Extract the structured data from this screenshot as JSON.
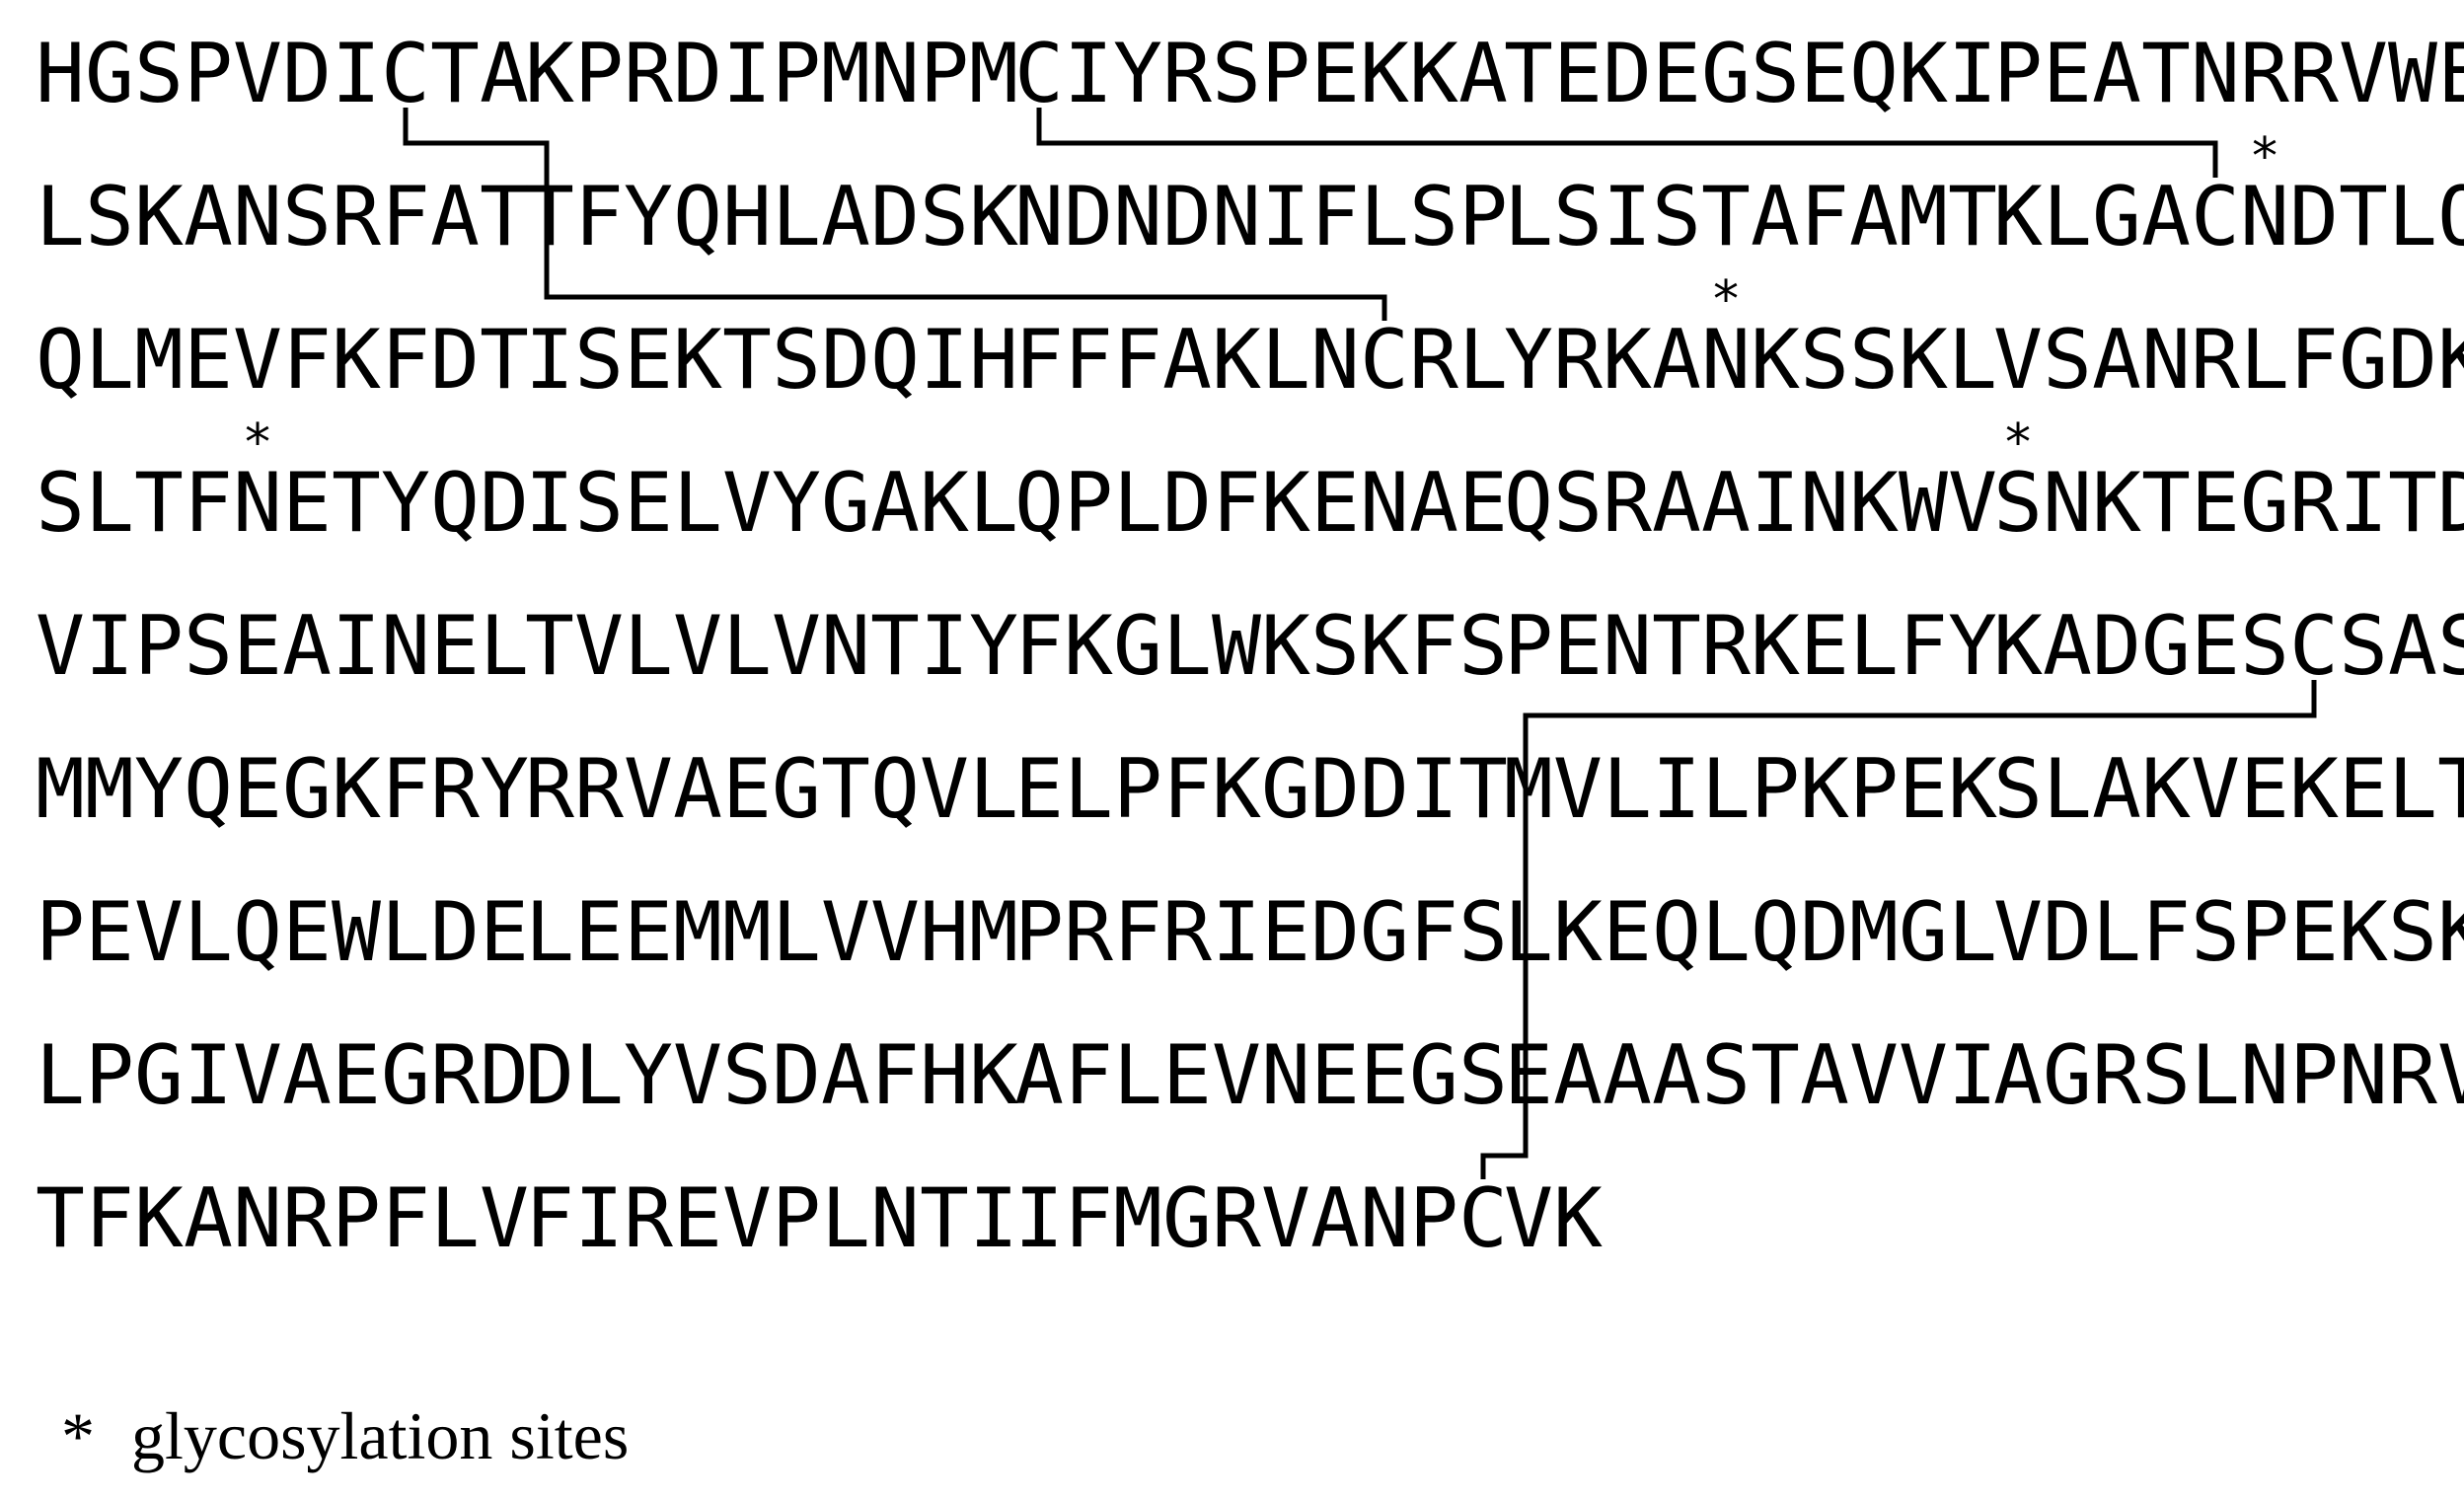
{
  "sequence_lines": [
    [
      "HGSPVDICTA",
      "KPRDIPMNPM",
      "CIYRSPEKKA",
      "TEDEGSEQKI",
      "PEATNRRVWE"
    ],
    [
      "LSKANSRFAT",
      "TFYQHLADSK",
      "NDNDNIFLSP",
      "LSISTAFAMT",
      "KLGACNDTLQ"
    ],
    [
      "QLMEVFKFDT",
      "ISEKTSDQIH",
      "FFFAKLNCRL",
      "YRKANKSSKL",
      "VSANRLFGDK"
    ],
    [
      "SLTFNETYQD",
      "ISELVYGAKL",
      "QPLDFKENAE",
      "QSRAAINKWV",
      "SNKTEGRITD"
    ],
    [
      "VIPSEAINEL",
      "TVLVLVNTIY",
      "FKGLWKSKFS",
      "PENTRKELFY",
      "KADGESCSAS"
    ],
    [
      "MMYQEGKFRY",
      "RRVAEGTQVL",
      "ELPFKGDDIT",
      "MVLILPKPEK",
      "SLAKVEKELT"
    ],
    [
      "PEVLQEWLDE",
      "LEEMMLVVHM",
      "PRFRIEDGFS",
      "LKEQLQDMGL",
      "VDLFSPEKSK"
    ],
    [
      "LPGIVAEGRD",
      "DLYVSDAFHK",
      "AFLEVNEEGS",
      "EAAASTAVVI",
      "AGRSLNPNRV"
    ],
    [
      "TFKANRPFLV",
      "FIREVPLNTI",
      "IFMGRVANPC",
      "VK"
    ]
  ],
  "glycosylation_marker": "*",
  "glycosylation_sites": [
    {
      "line": 1,
      "block": 4,
      "residue": 5
    },
    {
      "line": 2,
      "block": 3,
      "residue": 4
    },
    {
      "line": 3,
      "block": 0,
      "residue": 4
    },
    {
      "line": 3,
      "block": 4,
      "residue": 0
    }
  ],
  "disulfide_bonds": [
    {
      "from": {
        "line": 0,
        "block": 0,
        "residue": 7
      },
      "to": {
        "line": 2,
        "block": 2,
        "residue": 7
      }
    },
    {
      "from": {
        "line": 0,
        "block": 2,
        "residue": 0
      },
      "to": {
        "line": 1,
        "block": 4,
        "residue": 4
      }
    },
    {
      "from": {
        "line": 4,
        "block": 4,
        "residue": 6
      },
      "to": {
        "line": 8,
        "block": 2,
        "residue": 9
      }
    }
  ],
  "legend": {
    "marker": "*",
    "text": "glycosylation sites"
  }
}
